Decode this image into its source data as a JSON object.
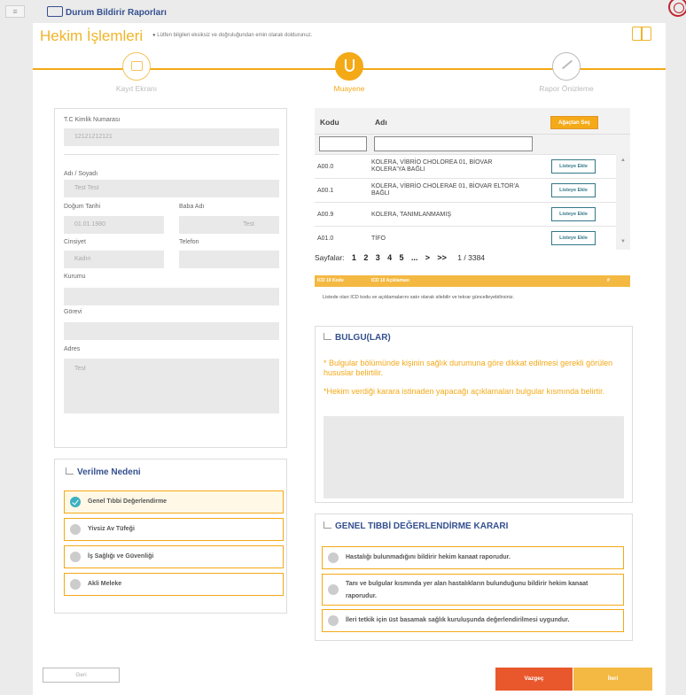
{
  "topbar": {
    "menu_glyph": "≡",
    "app_title": "Durum Bildirir Raporları"
  },
  "header": {
    "title": "Hekim İşlemleri",
    "note": "Lütfen bilgileri eksiksiz ve doğruluğundan emin olarak doldurunuz."
  },
  "steps": [
    {
      "label": "Kayıt Ekranı",
      "icon": "id-card-icon"
    },
    {
      "label": "Muayene",
      "icon": "stethoscope-icon"
    },
    {
      "label": "Rapor Önizleme",
      "icon": "pdf-icon"
    }
  ],
  "patient": {
    "tc_label": "T.C Kimlik Numarası",
    "tc_value": "12121212121",
    "name_label": "Adı / Soyadı",
    "name_value": "Test Test",
    "birth_label": "Doğum Tarihi",
    "birth_value": "01.01.1980",
    "father_label": "Baba Adı",
    "father_value": "Test",
    "gender_label": "Cinsiyet",
    "gender_value": "Kadın",
    "phone_label": "Telefon",
    "phone_value": "",
    "org_label": "Kurumu",
    "org_value": "",
    "duty_label": "Görevi",
    "duty_value": "",
    "address_label": "Adres",
    "address_value": "Test"
  },
  "reason": {
    "title": "Verilme Nedeni",
    "options": [
      "Genel Tıbbi Değerlendirme",
      "Yivsiz Av Tüfeği",
      "İş Sağlığı ve Güvenliği",
      "Akli Meleke"
    ],
    "selected_index": 0
  },
  "icd": {
    "col_code": "Kodu",
    "col_name": "Adı",
    "tree_button": "Ağaçtan Seç",
    "add_label": "Listeye Ekle",
    "rows": [
      {
        "code": "A00.0",
        "name": "KOLERA, VİBRİO CHOLOREA 01, BİOVAR KOLERA'YA BAĞLI"
      },
      {
        "code": "A00.1",
        "name": "KOLERA, VİBRİO CHOLERAE 01, BİOVAR ELTOR'A BAĞLI"
      },
      {
        "code": "A00.9",
        "name": "KOLERA, TANIMLANMAMIŞ"
      },
      {
        "code": "A01.0",
        "name": "TİFO"
      }
    ],
    "pager": {
      "label": "Sayfalar:",
      "pages": [
        "1",
        "2",
        "3",
        "4",
        "5",
        "...",
        ">",
        ">>"
      ],
      "info": "1 / 3384"
    },
    "selected_header": {
      "code": "ICD 10 Kodu",
      "desc": "ICD 10 Açıklaması",
      "hash": "#"
    },
    "note": "Listede olan ICD kodu ve açıklamalarını satır olarak silebilir ve tekrar güncelleyebilirsiniz."
  },
  "bulgu": {
    "title": "BULGU(LAR)",
    "text1": "* Bulgular bölümünde kişinin sağlık durumuna göre dikkat edilmesi gerekli görülen hususlar belirtilir.",
    "text2": "*Hekim verdiği karara istinaden yapacağı açıklamaları bulgular kısmında belirtir."
  },
  "decision": {
    "title": "GENEL TIBBİ DEĞERLENDİRME KARARI",
    "options": [
      "Hastalığı bulunmadığını bildirir hekim kanaat raporudur.",
      "Tanı ve bulgular kısmında yer alan hastalıkların bulunduğunu bildirir hekim kanaat raporudur.",
      "İleri tetkik için üst basamak sağlık kuruluşunda değerlendirilmesi uygundur."
    ]
  },
  "footer": {
    "back": "Geri",
    "cancel": "Vazgeç",
    "next": "İleri"
  },
  "colors": {
    "accent": "#f4a917",
    "brand": "#34508f",
    "cancel": "#e8582c",
    "next": "#f4b942"
  }
}
